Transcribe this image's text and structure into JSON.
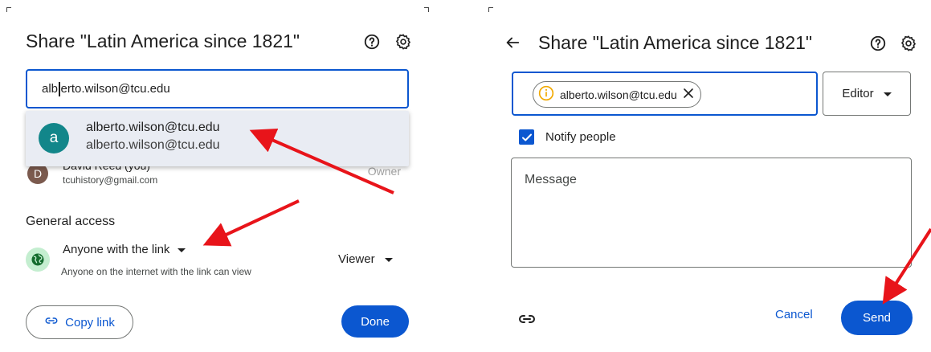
{
  "left_dialog": {
    "title": "Share \"Latin America since 1821\"",
    "help_icon": "help-circle-icon",
    "settings_icon": "gear-icon",
    "email_input": {
      "value_before_caret": "alb",
      "value_after_caret": "erto.wilson@tcu.edu"
    },
    "suggestion": {
      "avatar_letter": "a",
      "name": "alberto.wilson@tcu.edu",
      "email": "alberto.wilson@tcu.edu"
    },
    "owner": {
      "avatar_letter": "D",
      "name": "David Reed (you)",
      "email": "tcuhistory@gmail.com",
      "role": "Owner"
    },
    "general_access_label": "General access",
    "access_option": "Anyone with the link",
    "access_description": "Anyone on the internet with the link can view",
    "access_role": "Viewer",
    "copy_link_label": "Copy link",
    "done_label": "Done"
  },
  "right_dialog": {
    "title": "Share \"Latin America since 1821\"",
    "back_icon": "arrow-left-icon",
    "help_icon": "help-circle-icon",
    "settings_icon": "gear-icon",
    "recipient_chip": "alberto.wilson@tcu.edu",
    "role": "Editor",
    "notify_label": "Notify people",
    "notify_checked": true,
    "message_placeholder": "Message",
    "cancel_label": "Cancel",
    "send_label": "Send"
  },
  "colors": {
    "primary": "#0b57d0",
    "suggestion_avatar": "#12868a",
    "owner_avatar": "#7b5a4e",
    "globe_bg": "#c4eed0",
    "warning": "#f2a900",
    "annotation_arrow": "#e8141a"
  }
}
